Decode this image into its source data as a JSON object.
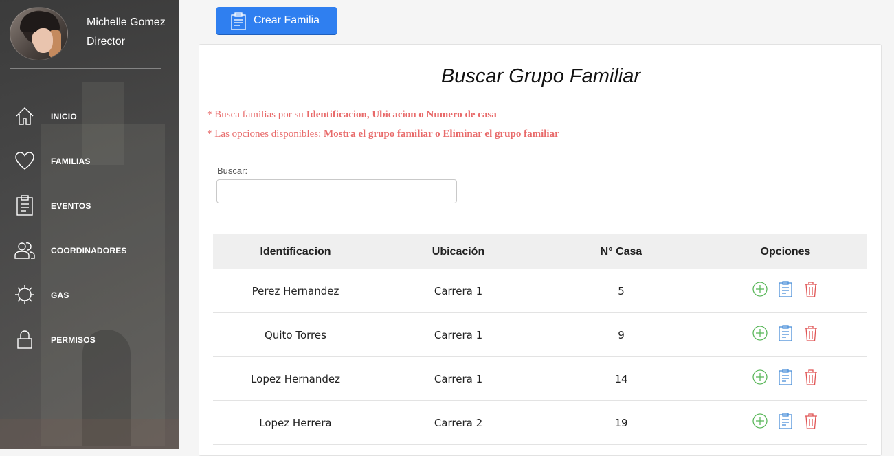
{
  "profile": {
    "name": "Michelle Gomez",
    "role": "Director"
  },
  "nav": [
    {
      "label": "INICIO",
      "icon": "home-icon"
    },
    {
      "label": "FAMILIAS",
      "icon": "heart-icon"
    },
    {
      "label": "EVENTOS",
      "icon": "clipboard-icon"
    },
    {
      "label": "COORDINADORES",
      "icon": "users-icon"
    },
    {
      "label": "GAS",
      "icon": "gear-icon"
    },
    {
      "label": "PERMISOS",
      "icon": "lock-icon"
    }
  ],
  "toolbar": {
    "create_label": "Crear Familia"
  },
  "card": {
    "title": "Buscar Grupo Familiar",
    "hint1_prefix": "* Busca familias por su ",
    "hint1_bold": "Identificacion, Ubicacion o Numero de casa",
    "hint2_prefix": "* Las opciones disponibles: ",
    "hint2_bold": "Mostra el grupo familiar o Eliminar el grupo familiar"
  },
  "search": {
    "label": "Buscar:",
    "value": "",
    "placeholder": ""
  },
  "table": {
    "headers": [
      "Identificacion",
      "Ubicación",
      "N° Casa",
      "Opciones"
    ],
    "rows": [
      [
        "Perez Hernandez",
        "Carrera 1",
        "5"
      ],
      [
        "Quito Torres",
        "Carrera 1",
        "9"
      ],
      [
        "Lopez Hernandez",
        "Carrera 1",
        "14"
      ],
      [
        "Lopez Herrera",
        "Carrera 2",
        "19"
      ]
    ]
  },
  "colors": {
    "primary_button": "#2f7ff0",
    "hint_text": "#e86a6a",
    "add_icon": "#5cb85c",
    "view_icon": "#4a8fd9",
    "delete_icon": "#e05555"
  }
}
